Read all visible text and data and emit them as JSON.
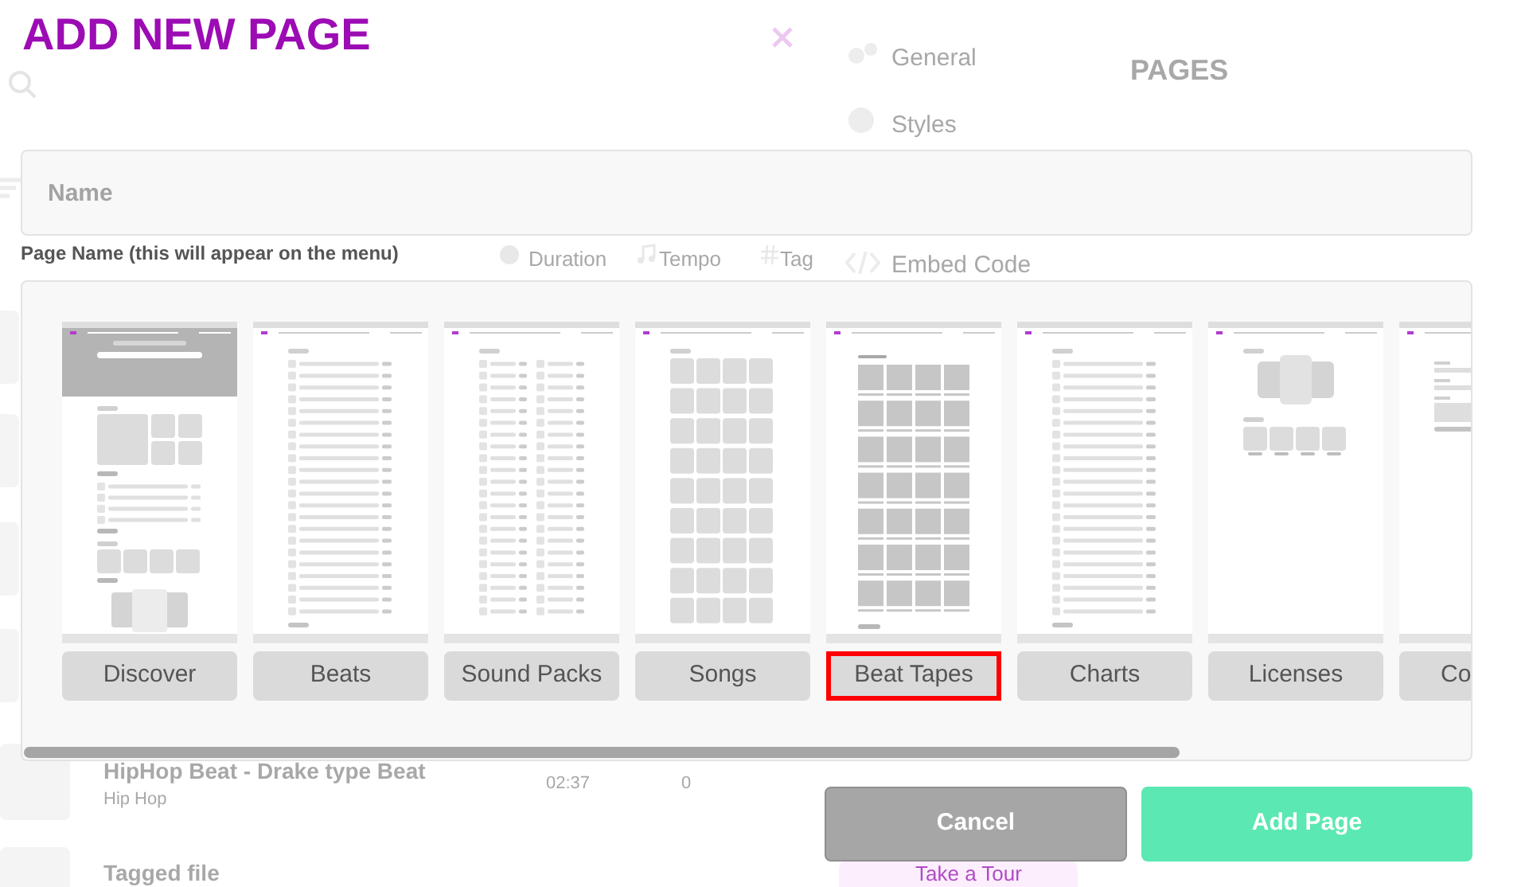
{
  "background": {
    "settings_tabs": [
      "General",
      "Styles",
      "Embed Code"
    ],
    "panel_title": "PAGES",
    "columns": [
      "Duration",
      "Tempo",
      "Tag"
    ],
    "tracks": [
      {
        "title": "HipHop Beat - Drake type Beat",
        "genre": "Hip Hop",
        "duration": "02:37",
        "plays": "0"
      },
      {
        "title": "Tagged file"
      }
    ],
    "tour_button": "Take a Tour"
  },
  "dialog": {
    "title": "ADD NEW PAGE",
    "name_field": {
      "placeholder": "Name"
    },
    "name_hint": "Page Name (this will appear on the menu)",
    "templates": [
      {
        "label": "Discover",
        "kind": "discover",
        "selected": false
      },
      {
        "label": "Beats",
        "kind": "list",
        "selected": false
      },
      {
        "label": "Sound Packs",
        "kind": "double-list",
        "selected": false
      },
      {
        "label": "Songs",
        "kind": "grid",
        "selected": false
      },
      {
        "label": "Beat Tapes",
        "kind": "tape-grid",
        "selected": true
      },
      {
        "label": "Charts",
        "kind": "list",
        "selected": false
      },
      {
        "label": "Licenses",
        "kind": "licenses",
        "selected": false
      },
      {
        "label": "Co",
        "kind": "form",
        "selected": false
      }
    ],
    "buttons": [
      {
        "label": "Cancel",
        "kind": "secondary"
      },
      {
        "label": "Add Page",
        "kind": "primary"
      }
    ]
  }
}
